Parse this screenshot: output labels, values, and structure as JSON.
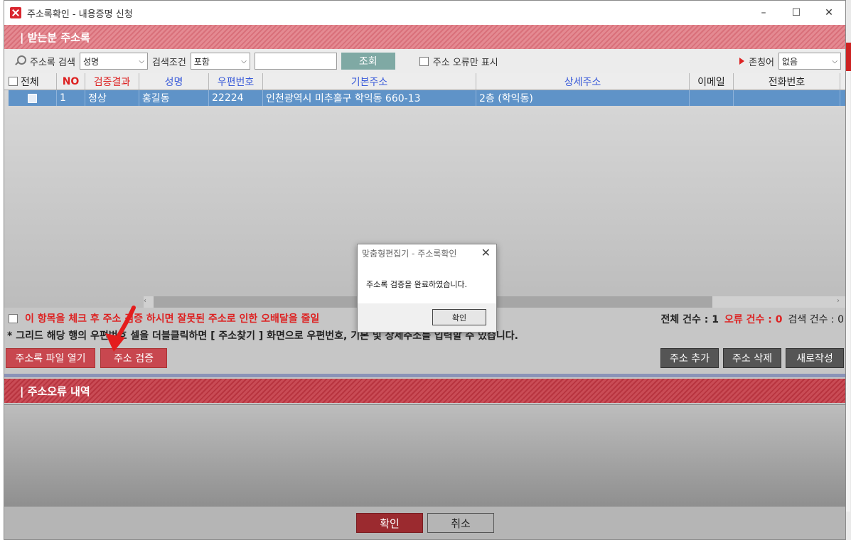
{
  "window": {
    "title": "주소록확인 - 내용증명 신청",
    "minimize": "–",
    "maximize": "☐",
    "close": "✕"
  },
  "recipients": {
    "header": "| 받는분 주소록",
    "search_label": "주소록 검색",
    "search_field_value": "성명",
    "condition_label": "검색조건",
    "condition_value": "포함",
    "search_input_value": "",
    "query_button": "조회",
    "error_only_label": "주소 오류만 표시",
    "honorific_label": "존칭어",
    "honorific_value": "없음"
  },
  "grid": {
    "columns": [
      "전체",
      "NO",
      "검증결과",
      "성명",
      "우편번호",
      "기본주소",
      "상세주소",
      "이메일",
      "전화번호"
    ],
    "rows": [
      {
        "no": "1",
        "result": "정상",
        "name": "홍길동",
        "zip": "22224",
        "address": "인천광역시 미추홀구 학익동 660-13",
        "detail": "2층 (학익동)",
        "email": "",
        "phone": ""
      }
    ]
  },
  "info": {
    "warning": "이 항목을 체크 후 주소 검증 하시면 잘못된 주소로 인한 오배달을 줄일",
    "total_label": "전체 건수 : 1",
    "error_label": "오류 건수 : 0",
    "search_count_label": "검색 건수 : 0",
    "hint": "* 그리드 해당 행의 우편번호 셀을 더블클릭하면 [ 주소찾기 ] 화면으로 우편번호, 기본 및 상세주소를 입력할 수 있습니다."
  },
  "actions": {
    "open_file": "주소록 파일 열기",
    "verify": "주소 검증",
    "add": "주소 추가",
    "delete": "주소 삭제",
    "new": "새로작성"
  },
  "errors": {
    "header": "| 주소오류 내역"
  },
  "footer": {
    "ok": "확인",
    "cancel": "취소"
  },
  "dialog": {
    "title": "맞춤형편집기 - 주소록확인",
    "close": "✕",
    "message": "주소록 검증을 완료하였습니다.",
    "ok": "확인"
  },
  "colors": {
    "header_pink": "#e48a92",
    "header_red": "#c94c56",
    "selection_blue": "#5f93c8",
    "accent_red": "#dd2222",
    "query_teal": "#7fa9a4"
  }
}
